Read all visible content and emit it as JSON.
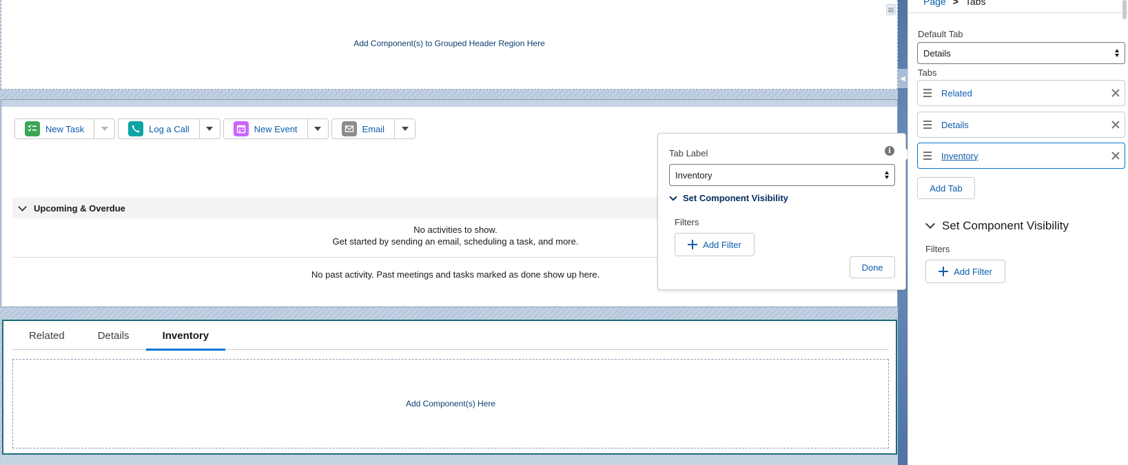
{
  "canvas": {
    "header_region": {
      "drop_text": "Add Component(s) to Grouped Header Region Here"
    },
    "activity": {
      "actions": [
        {
          "label": "New Task",
          "icon": "new-task-icon",
          "color": "#3ba755",
          "dropdown_disabled": true
        },
        {
          "label": "Log a Call",
          "icon": "log-call-icon",
          "color": "#0fa3a3",
          "dropdown_disabled": false
        },
        {
          "label": "New Event",
          "icon": "new-event-icon",
          "color": "#cb65ff",
          "dropdown_disabled": false
        },
        {
          "label": "Email",
          "icon": "email-icon",
          "color": "#8c8c8c",
          "dropdown_disabled": false
        }
      ],
      "upcoming_title": "Upcoming & Overdue",
      "no_activities_line1": "No activities to show.",
      "no_activities_line2": "Get started by sending an email, scheduling a task, and more.",
      "no_past_activity": "No past activity. Past meetings and tasks marked as done show up here."
    },
    "tabs_region": {
      "tabs": [
        "Related",
        "Details",
        "Inventory"
      ],
      "active_tab": "Inventory",
      "drop_text": "Add Component(s) Here"
    }
  },
  "popover": {
    "tab_label_title": "Tab Label",
    "tab_label_value": "Inventory",
    "visibility_title": "Set Component Visibility",
    "filters_label": "Filters",
    "add_filter_label": "Add Filter",
    "done_label": "Done"
  },
  "panel": {
    "breadcrumb": {
      "parent": "Page",
      "separator": ">",
      "current": "Tabs"
    },
    "default_tab_label": "Default Tab",
    "default_tab_value": "Details",
    "tabs_label": "Tabs",
    "tab_items": [
      "Related",
      "Details",
      "Inventory"
    ],
    "selected_tab_item": "Inventory",
    "add_tab_label": "Add Tab",
    "visibility_title": "Set Component Visibility",
    "filters_label": "Filters",
    "add_filter_label": "Add Filter"
  },
  "colors": {
    "accent": "#0176d3",
    "link": "#0b5cab",
    "tabs_region_border": "#1b6b7a"
  }
}
